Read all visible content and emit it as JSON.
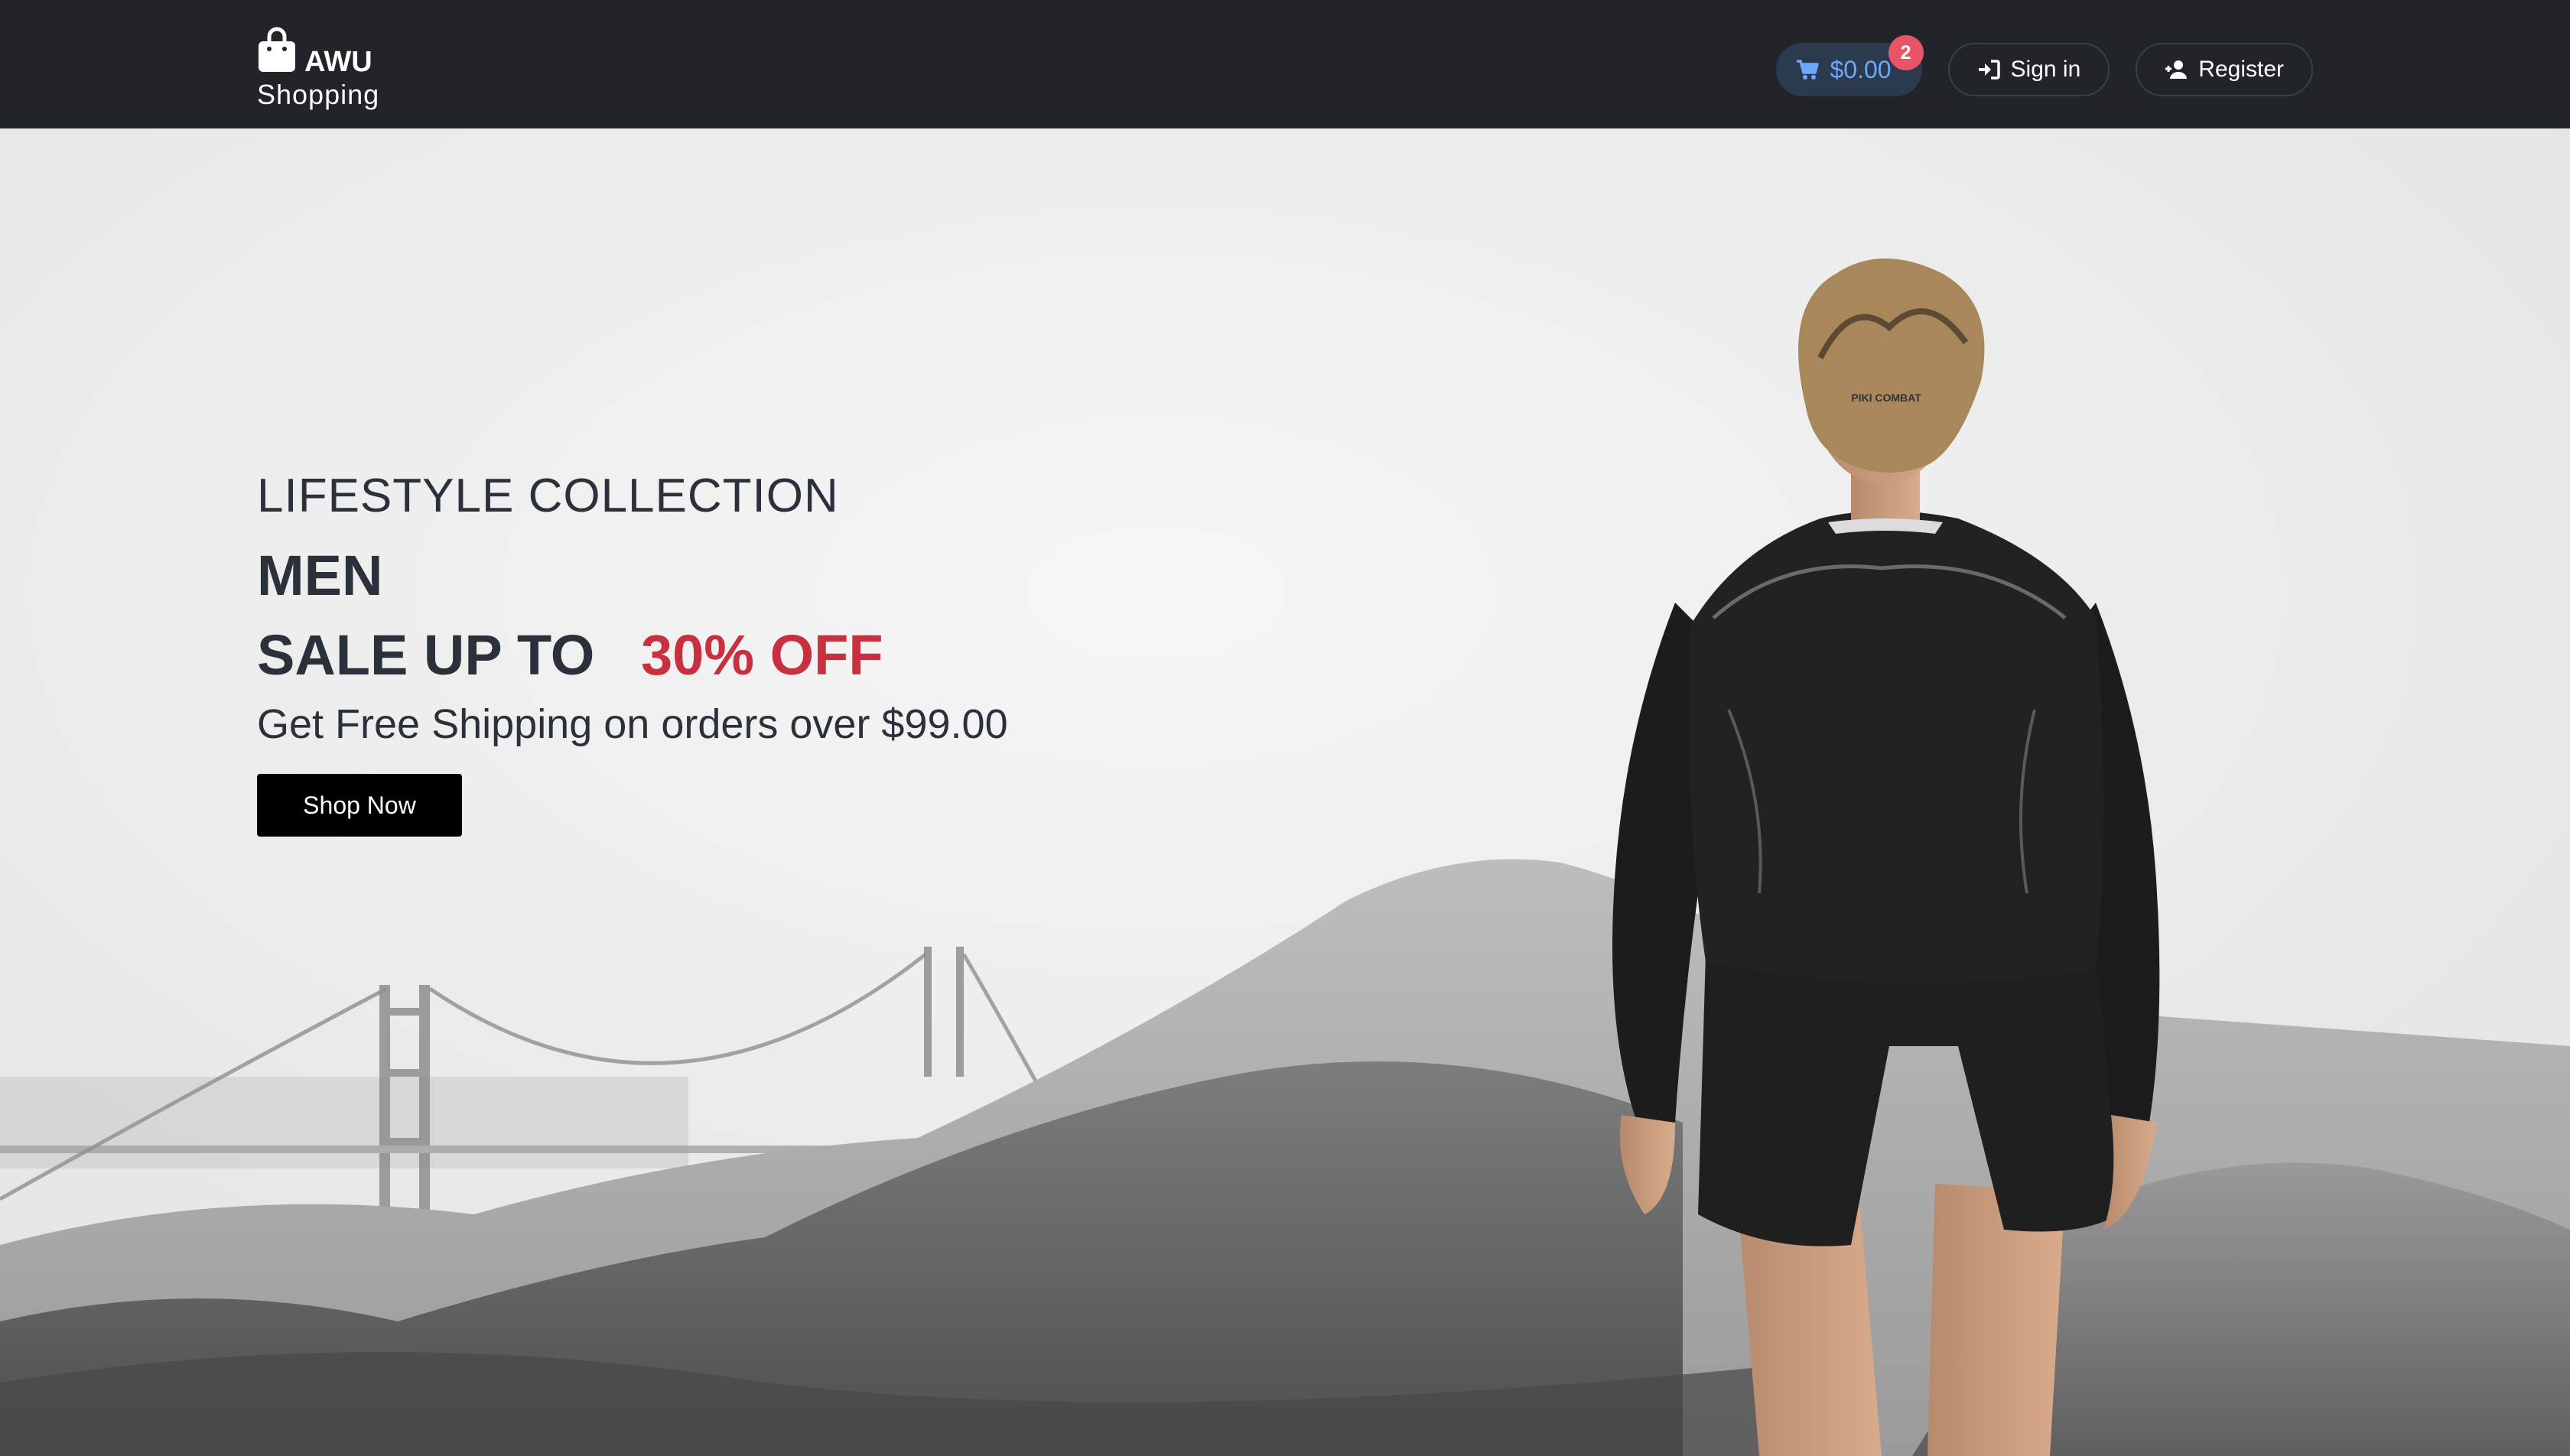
{
  "header": {
    "brand_name": "AWU",
    "brand_sub": "Shopping",
    "cart_total": "$0.00",
    "cart_count": "2",
    "sign_in_label": "Sign in",
    "register_label": "Register"
  },
  "hero": {
    "tagline": "LIFESTYLE COLLECTION",
    "headline": "MEN",
    "sale_prefix": "SALE UP TO",
    "sale_percent": "30% OFF",
    "shipping_note": "Get Free Shipping on orders over $99.00",
    "cta_label": "Shop Now",
    "shirt_print": "PIKI COMBAT"
  },
  "colors": {
    "navbar_bg": "#212529",
    "cart_text": "#6ea8fe",
    "badge": "#ea5468",
    "sale_accent": "#c9303f",
    "cta_bg": "#000000"
  },
  "icons": {
    "logo": "shopping-bag-icon",
    "cart": "cart-icon",
    "sign_in": "sign-in-icon",
    "register": "user-plus-icon"
  }
}
